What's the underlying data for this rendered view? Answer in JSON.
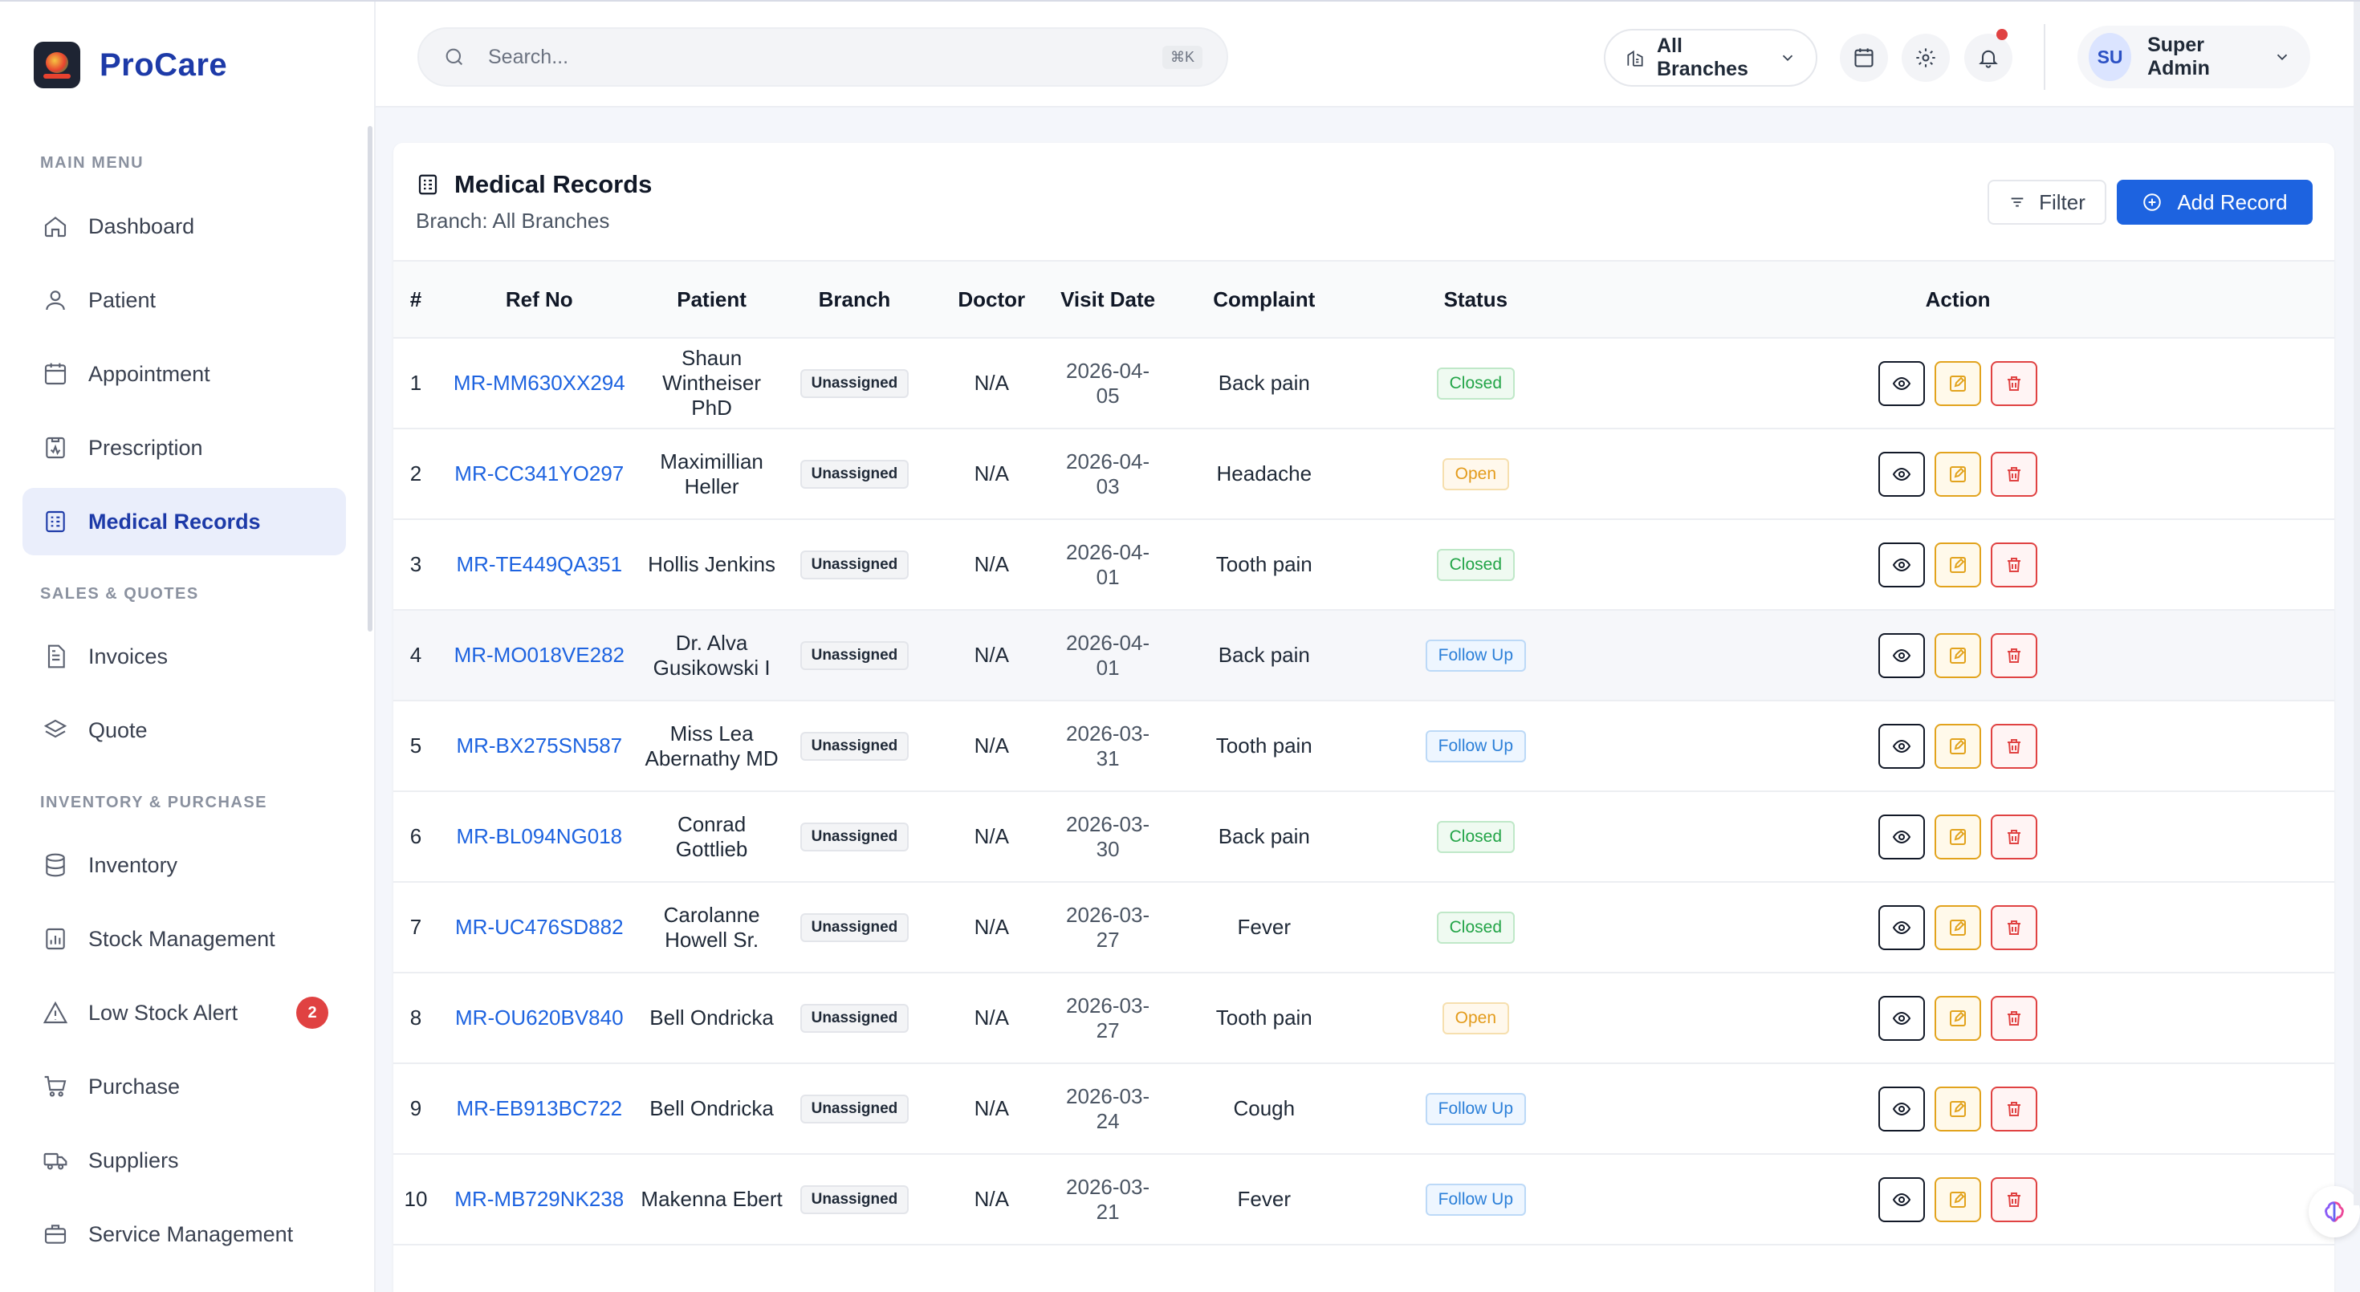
{
  "brand": {
    "name": "ProCare"
  },
  "sidebar": {
    "sections": [
      "MAIN MENU",
      "SALES & QUOTES",
      "INVENTORY & PURCHASE"
    ],
    "items": [
      {
        "label": "Dashboard",
        "icon": "home-icon"
      },
      {
        "label": "Patient",
        "icon": "user-icon"
      },
      {
        "label": "Appointment",
        "icon": "calendar-icon"
      },
      {
        "label": "Prescription",
        "icon": "prescription-icon"
      },
      {
        "label": "Medical Records",
        "icon": "records-icon",
        "active": true
      },
      {
        "label": "Invoices",
        "icon": "invoice-icon"
      },
      {
        "label": "Quote",
        "icon": "layers-icon"
      },
      {
        "label": "Inventory",
        "icon": "database-icon"
      },
      {
        "label": "Stock Management",
        "icon": "bar-chart-icon"
      },
      {
        "label": "Low Stock Alert",
        "icon": "warning-icon",
        "badge": "2"
      },
      {
        "label": "Purchase",
        "icon": "cart-icon"
      },
      {
        "label": "Suppliers",
        "icon": "truck-icon"
      },
      {
        "label": "Service Management",
        "icon": "briefcase-icon"
      }
    ]
  },
  "header": {
    "search_placeholder": "Search...",
    "search_shortcut": "⌘K",
    "branch_selector": "All Branches",
    "user": {
      "initials": "SU",
      "name": "Super Admin"
    }
  },
  "page": {
    "title": "Medical Records",
    "subtitle": "Branch: All Branches",
    "filter_label": "Filter",
    "add_label": "Add Record"
  },
  "table": {
    "columns": [
      "#",
      "Ref No",
      "Patient",
      "Branch",
      "Doctor",
      "Visit Date",
      "Complaint",
      "Status",
      "Action"
    ],
    "rows": [
      {
        "no": "1",
        "ref": "MR-MM630XX294",
        "patient": "Shaun Wintheiser PhD",
        "branch": "Unassigned",
        "doctor": "N/A",
        "date": "2026-04-05",
        "complaint": "Back pain",
        "status": "Closed"
      },
      {
        "no": "2",
        "ref": "MR-CC341YO297",
        "patient": "Maximillian Heller",
        "branch": "Unassigned",
        "doctor": "N/A",
        "date": "2026-04-03",
        "complaint": "Headache",
        "status": "Open"
      },
      {
        "no": "3",
        "ref": "MR-TE449QA351",
        "patient": "Hollis Jenkins",
        "branch": "Unassigned",
        "doctor": "N/A",
        "date": "2026-04-01",
        "complaint": "Tooth pain",
        "status": "Closed"
      },
      {
        "no": "4",
        "ref": "MR-MO018VE282",
        "patient": "Dr. Alva Gusikowski I",
        "branch": "Unassigned",
        "doctor": "N/A",
        "date": "2026-04-01",
        "complaint": "Back pain",
        "status": "Follow Up"
      },
      {
        "no": "5",
        "ref": "MR-BX275SN587",
        "patient": "Miss Lea Abernathy MD",
        "branch": "Unassigned",
        "doctor": "N/A",
        "date": "2026-03-31",
        "complaint": "Tooth pain",
        "status": "Follow Up"
      },
      {
        "no": "6",
        "ref": "MR-BL094NG018",
        "patient": "Conrad Gottlieb",
        "branch": "Unassigned",
        "doctor": "N/A",
        "date": "2026-03-30",
        "complaint": "Back pain",
        "status": "Closed"
      },
      {
        "no": "7",
        "ref": "MR-UC476SD882",
        "patient": "Carolanne Howell Sr.",
        "branch": "Unassigned",
        "doctor": "N/A",
        "date": "2026-03-27",
        "complaint": "Fever",
        "status": "Closed"
      },
      {
        "no": "8",
        "ref": "MR-OU620BV840",
        "patient": "Bell Ondricka",
        "branch": "Unassigned",
        "doctor": "N/A",
        "date": "2026-03-27",
        "complaint": "Tooth pain",
        "status": "Open"
      },
      {
        "no": "9",
        "ref": "MR-EB913BC722",
        "patient": "Bell Ondricka",
        "branch": "Unassigned",
        "doctor": "N/A",
        "date": "2026-03-24",
        "complaint": "Cough",
        "status": "Follow Up"
      },
      {
        "no": "10",
        "ref": "MR-MB729NK238",
        "patient": "Makenna Ebert",
        "branch": "Unassigned",
        "doctor": "N/A",
        "date": "2026-03-21",
        "complaint": "Fever",
        "status": "Follow Up"
      }
    ]
  },
  "colors": {
    "brand": "#1d3aa8",
    "primary": "#1d63e0",
    "closed": "#22a447",
    "open": "#e39b1b",
    "follow_up": "#2b7fd8",
    "danger": "#e04242"
  }
}
